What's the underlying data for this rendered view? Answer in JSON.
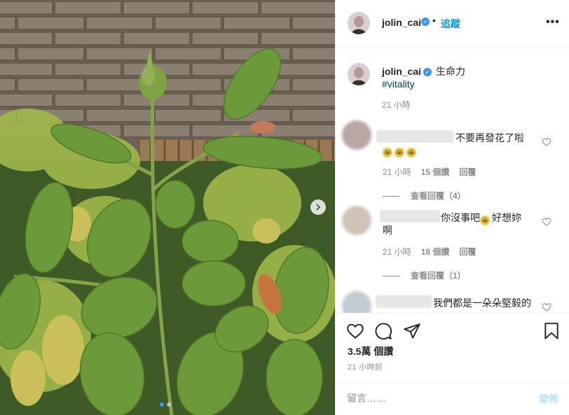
{
  "post": {
    "author": "jolin_cai",
    "verified": true,
    "follow_label": "追蹤",
    "header_separator": "•",
    "more_icon": "more-horizontal-icon",
    "caption_text": "生命力",
    "caption_hashtag": "#vitality",
    "caption_time": "21 小時",
    "views": "3.5萬 個讚",
    "posted_ago": "21 小時前",
    "photo_count": 2,
    "active_photo": 1
  },
  "comments": [
    {
      "text": "不要再發花了啦",
      "emojis": [
        "😭",
        "😭",
        "😭"
      ],
      "time": "21 小時",
      "likes": "15 個讚",
      "reply_label": "回覆",
      "view_replies": "查看回覆（4）"
    },
    {
      "text": "你沒事吧😭好想妳啊",
      "text_line1": "你沒事吧",
      "emoji": "😭",
      "text_line1_end": "好想妳",
      "text_line2": "啊",
      "time": "21 小時",
      "likes": "18 個讚",
      "reply_label": "回覆",
      "view_replies": "查看回覆（1）"
    },
    {
      "text": "我們都是一朵朵堅毅的"
    }
  ],
  "comment_input": {
    "placeholder": "留言……",
    "post_label": "發佈"
  },
  "colors": {
    "accent": "#0095f6",
    "verified": "#3897f0",
    "muted": "#8e8e8e",
    "post_disabled": "#b2dffc"
  },
  "icons": [
    "heart-icon",
    "comment-icon",
    "share-icon",
    "bookmark-icon",
    "chevron-right-icon",
    "verified-badge-icon"
  ]
}
